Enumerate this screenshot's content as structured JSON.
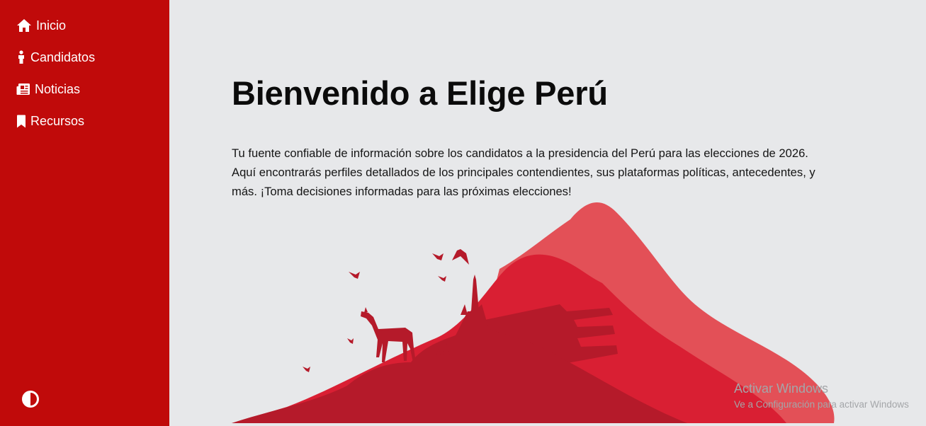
{
  "sidebar": {
    "items": [
      {
        "label": "Inicio",
        "icon": "home-icon"
      },
      {
        "label": "Candidatos",
        "icon": "person-icon"
      },
      {
        "label": "Noticias",
        "icon": "newspaper-icon"
      },
      {
        "label": "Recursos",
        "icon": "bookmark-icon"
      }
    ],
    "theme_toggle_icon": "contrast-icon",
    "background": "#c00a0a"
  },
  "main": {
    "title": "Bienvenido a Elige Perú",
    "intro": "Tu fuente confiable de información sobre los candidatos a la presidencia del Perú para las elecciones de 2026. Aquí encontrarás perfiles detallados de los principales contendientes, sus plataformas políticas, antecedentes, y más. ¡Toma decisiones informadas para las próximas elecciones!",
    "illustration_colors": [
      "#e35057",
      "#d91f33",
      "#b51a2a"
    ]
  },
  "watermark": {
    "title": "Activar Windows",
    "subtitle": "Ve a Configuración para activar Windows"
  }
}
